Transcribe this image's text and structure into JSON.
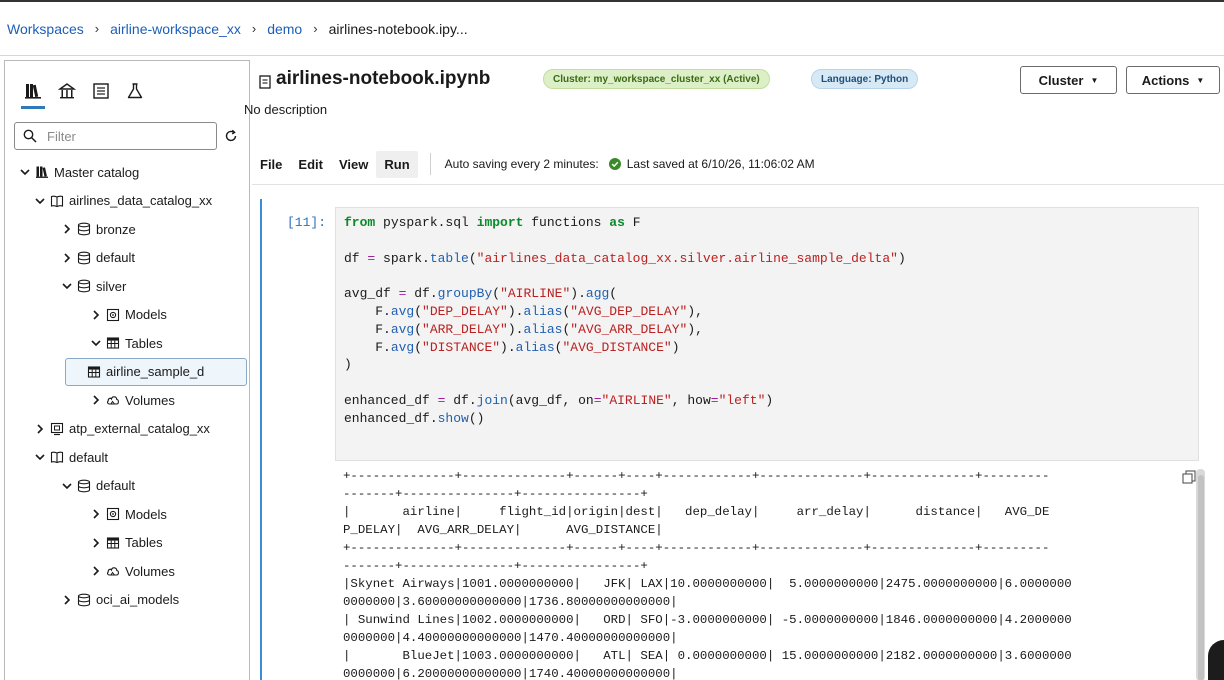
{
  "breadcrumb": {
    "items": [
      "Workspaces",
      "airline-workspace_xx",
      "demo",
      "airlines-notebook.ipy..."
    ],
    "separator": "›"
  },
  "sidebar": {
    "filter_placeholder": "Filter",
    "tree": [
      {
        "label": "Master catalog",
        "icon": "catalog-icon",
        "expanded": true,
        "level": 0
      },
      {
        "label": "airlines_data_catalog_xx",
        "icon": "book-icon",
        "expanded": true,
        "level": 1
      },
      {
        "label": "bronze",
        "icon": "database-icon",
        "expanded": false,
        "level": 2
      },
      {
        "label": "default",
        "icon": "database-icon",
        "expanded": false,
        "level": 2
      },
      {
        "label": "silver",
        "icon": "database-icon",
        "expanded": true,
        "level": 2
      },
      {
        "label": "Models",
        "icon": "model-icon",
        "expanded": false,
        "level": 3
      },
      {
        "label": "Tables",
        "icon": "table-icon",
        "expanded": true,
        "level": 3
      },
      {
        "label": "airline_sample_d",
        "icon": "table-icon",
        "selected": true,
        "level": 4
      },
      {
        "label": "Volumes",
        "icon": "volume-icon",
        "expanded": false,
        "level": 3
      },
      {
        "label": "atp_external_catalog_xx",
        "icon": "external-catalog-icon",
        "expanded": false,
        "level": 1
      },
      {
        "label": "default",
        "icon": "book-icon",
        "expanded": true,
        "level": 1
      },
      {
        "label": "default",
        "icon": "database-icon",
        "expanded": true,
        "level": 2
      },
      {
        "label": "Models",
        "icon": "model-icon",
        "expanded": false,
        "level": 3
      },
      {
        "label": "Tables",
        "icon": "table-icon",
        "expanded": false,
        "level": 3
      },
      {
        "label": "Volumes",
        "icon": "volume-icon",
        "expanded": false,
        "level": 3
      },
      {
        "label": "oci_ai_models",
        "icon": "database-icon",
        "expanded": false,
        "level": 2
      }
    ]
  },
  "notebook": {
    "title": "airlines-notebook.ipynb",
    "cluster_badge": "Cluster: my_workspace_cluster_xx (Active)",
    "language_badge": "Language: Python",
    "cluster_button": "Cluster",
    "actions_button": "Actions",
    "description": "No description",
    "menu": [
      "File",
      "Edit",
      "View",
      "Run"
    ],
    "autosave_text": "Auto saving every 2 minutes:",
    "last_saved": "Last saved at 6/10/26, 11:06:02 AM",
    "cell_prompt": "[11]:",
    "code_lines": [
      "from pyspark.sql import functions as F",
      "",
      "df = spark.table(\"airlines_data_catalog_xx.silver.airline_sample_delta\")",
      "",
      "avg_df = df.groupBy(\"AIRLINE\").agg(",
      "    F.avg(\"DEP_DELAY\").alias(\"AVG_DEP_DELAY\"),",
      "    F.avg(\"ARR_DELAY\").alias(\"AVG_ARR_DELAY\"),",
      "    F.avg(\"DISTANCE\").alias(\"AVG_DISTANCE\")",
      ")",
      "",
      "enhanced_df = df.join(avg_df, on=\"AIRLINE\", how=\"left\")",
      "enhanced_df.show()"
    ],
    "output_lines": [
      "+--------------+--------------+------+----+------------+--------------+--------------+---------",
      "-------+---------------+----------------+",
      "|       airline|     flight_id|origin|dest|   dep_delay|     arr_delay|      distance|   AVG_DE",
      "P_DELAY|  AVG_ARR_DELAY|      AVG_DISTANCE|",
      "+--------------+--------------+------+----+------------+--------------+--------------+---------",
      "-------+---------------+----------------+",
      "|Skynet Airways|1001.0000000000|   JFK| LAX|10.0000000000|  5.0000000000|2475.0000000000|6.0000000",
      "0000000|3.60000000000000|1736.80000000000000|",
      "| Sunwind Lines|1002.0000000000|   ORD| SFO|-3.0000000000| -5.0000000000|1846.0000000000|4.2000000",
      "0000000|4.40000000000000|1470.40000000000000|",
      "|       BlueJet|1003.0000000000|   ATL| SEA| 0.0000000000| 15.0000000000|2182.0000000000|3.6000000",
      "0000000|6.20000000000000|1740.40000000000000|"
    ]
  },
  "colors": {
    "link": "#1c5fb8",
    "cluster_badge_bg": "#dcefc6",
    "language_badge_bg": "#d8e9f6",
    "cell_indicator": "#3c8dd6",
    "saved_icon": "#3a8a2a"
  }
}
